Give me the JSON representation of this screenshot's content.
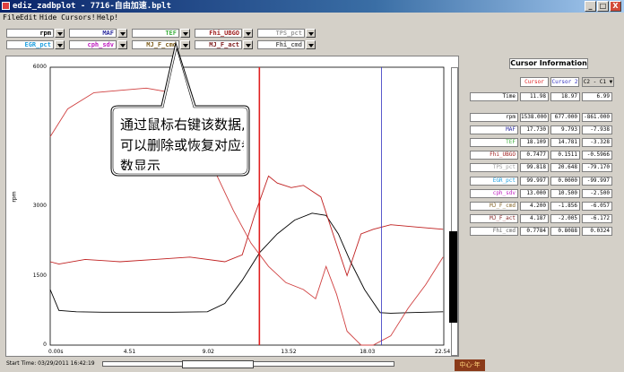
{
  "window": {
    "title": "ediz_zadbplot - 7716-自由加速.bplt",
    "buttons": [
      "_",
      "□",
      "X"
    ]
  },
  "menu": [
    "File",
    "Edit",
    "Hide Cursors!",
    "Help!"
  ],
  "signal_selectors": [
    {
      "label": "rpm",
      "color": "#000000"
    },
    {
      "label": "MAF",
      "color": "#3030a0"
    },
    {
      "label": "TEF",
      "color": "#40b040"
    },
    {
      "label": "Fhi_UBGO",
      "color": "#a02020"
    },
    {
      "label": "TPS_pct",
      "color": "#a0a0a0"
    },
    {
      "label": "EGR_pct",
      "color": "#20a0e0"
    },
    {
      "label": "cph_sdv",
      "color": "#c020c0"
    },
    {
      "label": "MJ_F_cmd",
      "color": "#806020"
    },
    {
      "label": "MJ_F_act",
      "color": "#802020"
    },
    {
      "label": "Fhi_cmd",
      "color": "#606060"
    }
  ],
  "chart_data": {
    "type": "line",
    "ylabel": "rpm",
    "xlim": [
      0.0,
      22.54
    ],
    "ylim": [
      0,
      6000
    ],
    "x_ticks": [
      "0.00s",
      "4.51",
      "9.02",
      "13.52",
      "18.03",
      "22.54"
    ],
    "y_ticks": [
      "0",
      "1500",
      "3000",
      "6000"
    ],
    "cursors": [
      {
        "name": "Cursor",
        "x": 11.98,
        "color": "#e02020"
      },
      {
        "name": "Cursor 2",
        "x": 18.97,
        "color": "#3030c0"
      }
    ],
    "series": [
      {
        "name": "rpm",
        "color": "#000000",
        "x": [
          0.0,
          0.5,
          1.5,
          3,
          5,
          7,
          9,
          10,
          11,
          12,
          13,
          14,
          15,
          15.8,
          16.5,
          17.2,
          18,
          18.9,
          19.5,
          20.5,
          21.5,
          22.5
        ],
        "y": [
          1200,
          750,
          720,
          710,
          710,
          710,
          720,
          900,
          1400,
          2000,
          2400,
          2700,
          2850,
          2800,
          2400,
          1800,
          1200,
          700,
          690,
          700,
          710,
          720
        ]
      },
      {
        "name": "Fhi_UBGO",
        "color": "#c02020",
        "x": [
          0.0,
          0.5,
          2,
          4,
          6,
          8,
          10,
          11,
          11.7,
          12.5,
          13,
          13.8,
          14.5,
          15.5,
          16.2,
          17,
          17.8,
          18.5,
          19.5,
          21,
          22.5
        ],
        "y": [
          1800,
          1750,
          1850,
          1800,
          1850,
          1900,
          1800,
          1950,
          2800,
          3650,
          3500,
          3400,
          3450,
          3200,
          2400,
          1500,
          2400,
          2500,
          2600,
          2550,
          2500
        ]
      },
      {
        "name": "MJ_F_act",
        "color": "#d04040",
        "x": [
          0.0,
          1,
          2.5,
          4,
          5.5,
          7,
          8.5,
          9.5,
          10.5,
          11.5,
          12.5,
          13.5,
          14.5,
          15.2,
          15.8,
          16.4,
          17,
          17.8,
          18.5,
          19.5,
          20.5,
          21.5,
          22.5
        ],
        "y": [
          4500,
          5100,
          5450,
          5500,
          5550,
          5450,
          4700,
          3700,
          2900,
          2200,
          1700,
          1350,
          1200,
          1000,
          1700,
          1100,
          300,
          0,
          0,
          200,
          800,
          1300,
          1900
        ]
      }
    ]
  },
  "status": {
    "start_time": "Start Time: 03/29/2011 16:42:19",
    "logo": "中心·年"
  },
  "cursor_panel": {
    "title": "Cursor Information",
    "col_cursor1": "Cursor",
    "col_cursor2": "Cursor 2",
    "col_diff": "C2 - C1",
    "time_row": {
      "name": "Time",
      "c1": "11.98",
      "c2": "18.97",
      "diff": "6.99"
    },
    "rows": [
      {
        "name": "rpm",
        "color": "#000000",
        "c1": "1538.000",
        "c2": "677.000",
        "diff": "-861.000"
      },
      {
        "name": "MAF",
        "color": "#3030a0",
        "c1": "17.730",
        "c2": "9.793",
        "diff": "-7.938"
      },
      {
        "name": "TEF",
        "color": "#40b040",
        "c1": "18.109",
        "c2": "14.781",
        "diff": "-3.328"
      },
      {
        "name": "Fhi_UBGO",
        "color": "#a02020",
        "c1": "0.7477",
        "c2": "0.1511",
        "diff": "-0.5966"
      },
      {
        "name": "TPS_pct",
        "color": "#a0a0a0",
        "c1": "99.818",
        "c2": "20.648",
        "diff": "-79.170"
      },
      {
        "name": "EGR_pct",
        "color": "#20a0e0",
        "c1": "99.997",
        "c2": "0.0000",
        "diff": "-99.997"
      },
      {
        "name": "cph_sdv",
        "color": "#c020c0",
        "c1": "13.000",
        "c2": "10.500",
        "diff": "-2.500"
      },
      {
        "name": "MJ_F_cmd",
        "color": "#806020",
        "c1": "4.200",
        "c2": "-1.856",
        "diff": "-6.057"
      },
      {
        "name": "MJ_F_act",
        "color": "#802020",
        "c1": "4.187",
        "c2": "-2.005",
        "diff": "-6.172"
      },
      {
        "name": "Fhi_cmd",
        "color": "#606060",
        "c1": "0.7784",
        "c2": "0.8088",
        "diff": "0.0324"
      }
    ]
  },
  "callout": {
    "line1": "通过鼠标右键该数据,",
    "line2": "可以删除或恢复对应参",
    "line3": "数显示"
  }
}
